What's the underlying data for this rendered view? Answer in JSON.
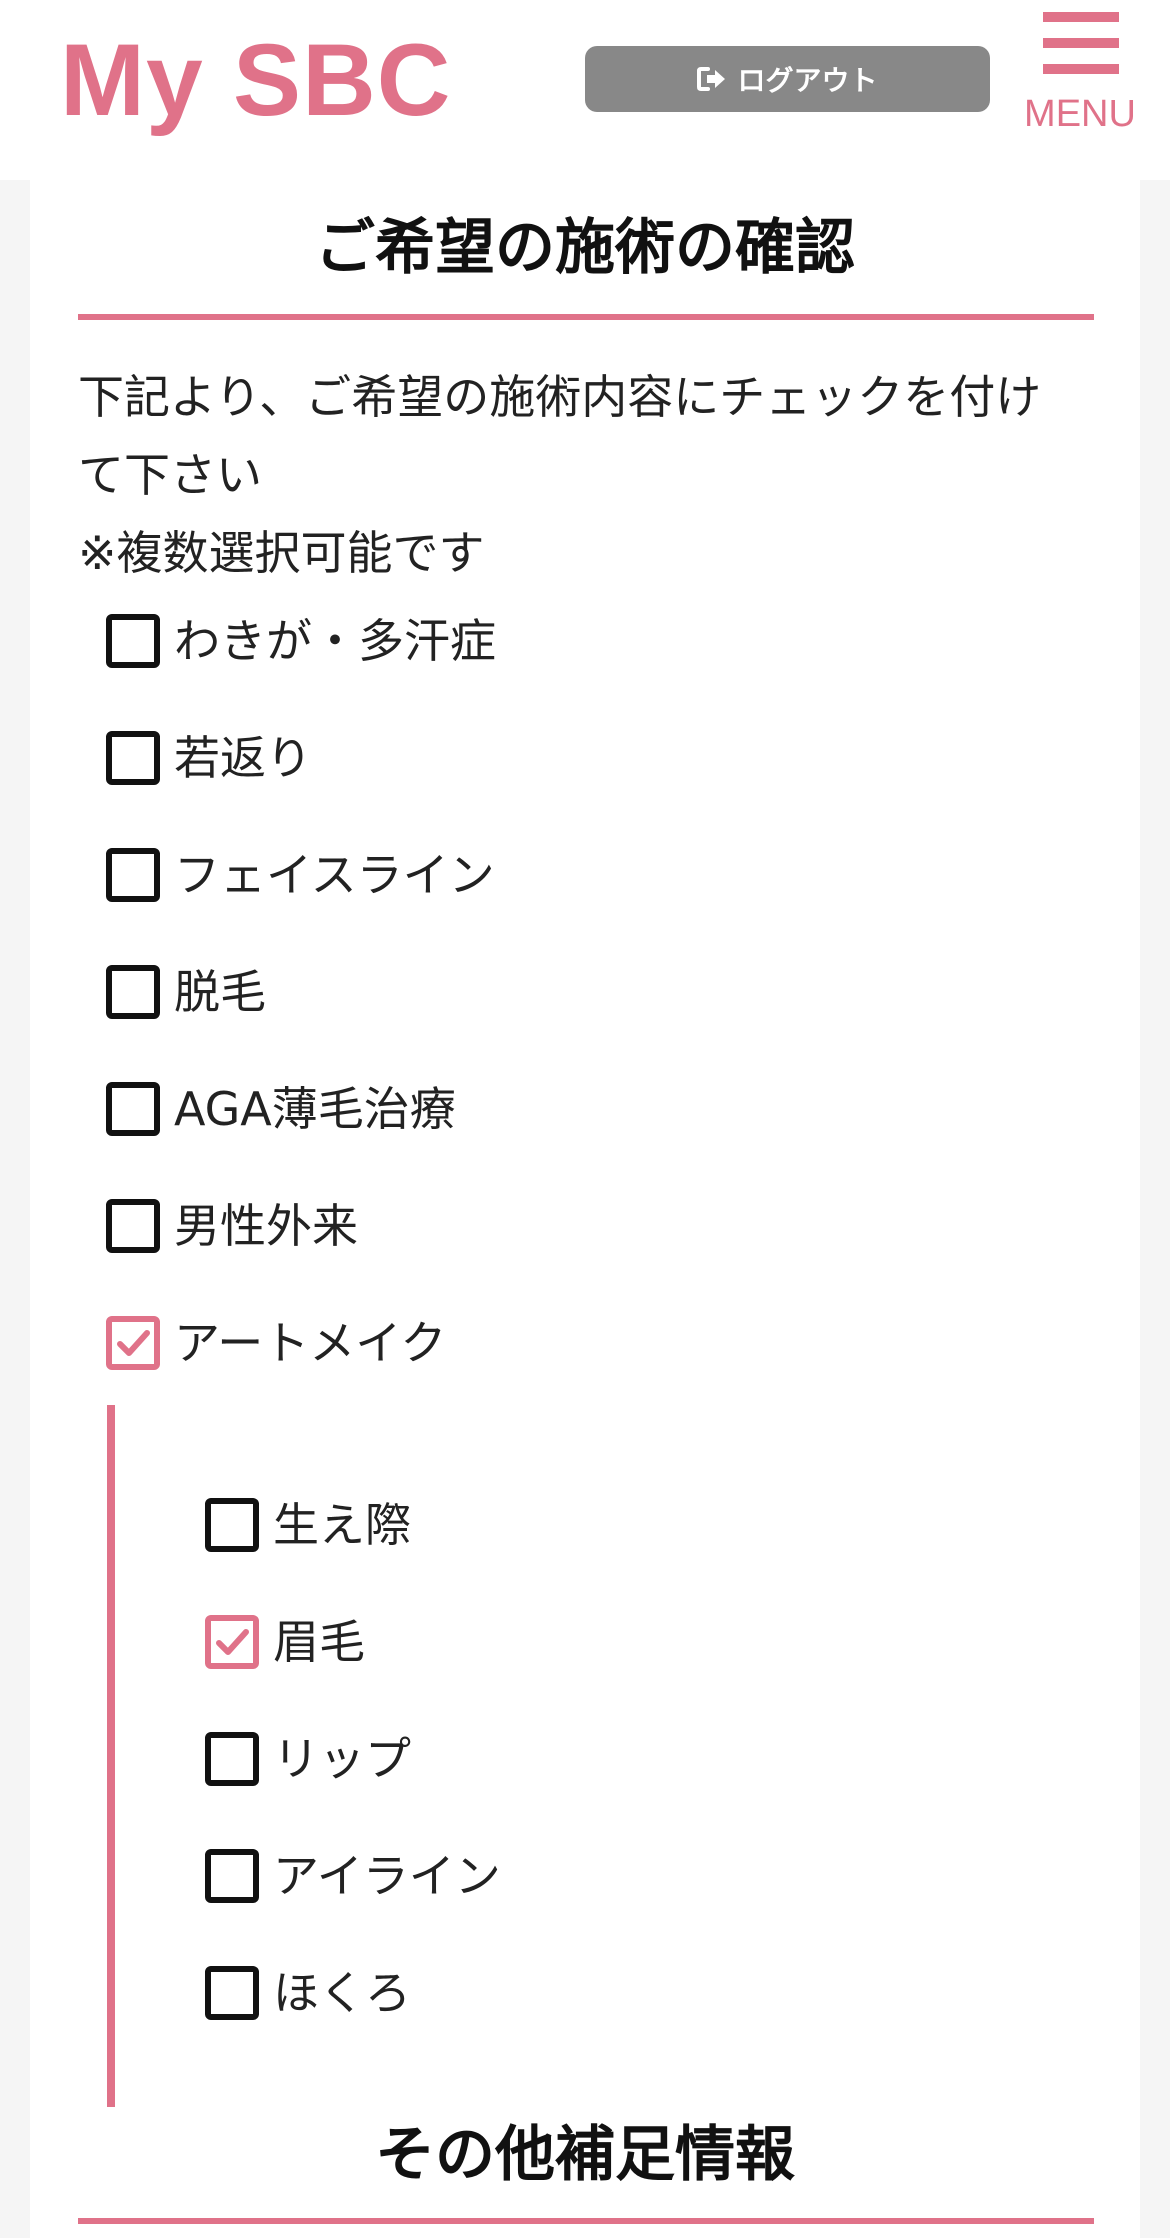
{
  "header": {
    "logo": "My SBC",
    "logout_label": "ログアウト",
    "logout_icon": "sign-out-icon",
    "menu_label": "MENU",
    "menu_icon": "hamburger-icon"
  },
  "colors": {
    "accent": "#e07289",
    "logout_bg": "#888888",
    "page_bg": "#f5f5f5"
  },
  "treatment": {
    "title": "ご希望の施術の確認",
    "intro_line1": "下記より、ご希望の施術内容にチェックを付け",
    "intro_line2": "て下さい",
    "intro_line3": "※複数選択可能です",
    "options": [
      {
        "label": "わきが・多汗症",
        "checked": false
      },
      {
        "label": "若返り",
        "checked": false
      },
      {
        "label": "フェイスライン",
        "checked": false
      },
      {
        "label": "脱毛",
        "checked": false
      },
      {
        "label": "AGA薄毛治療",
        "checked": false
      },
      {
        "label": "男性外来",
        "checked": false
      },
      {
        "label": "アートメイク",
        "checked": true
      }
    ],
    "sub_options": [
      {
        "label": "生え際",
        "checked": false
      },
      {
        "label": "眉毛",
        "checked": true
      },
      {
        "label": "リップ",
        "checked": false
      },
      {
        "label": "アイライン",
        "checked": false
      },
      {
        "label": "ほくろ",
        "checked": false
      }
    ]
  },
  "other": {
    "title": "その他補足情報"
  }
}
